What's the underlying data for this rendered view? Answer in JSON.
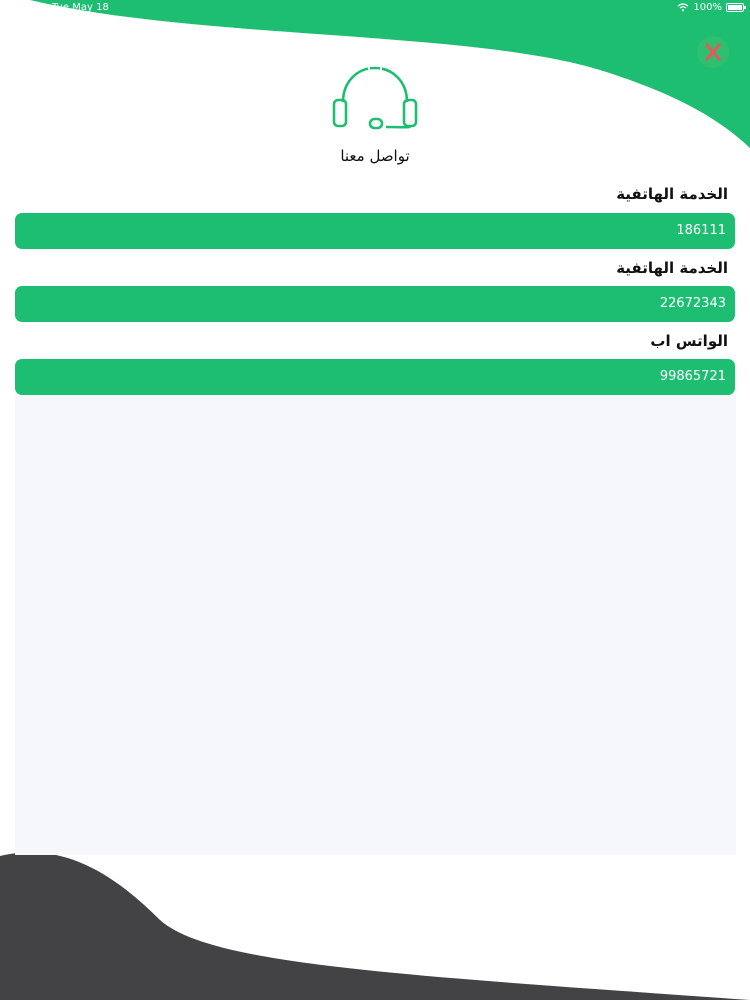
{
  "status_bar": {
    "time": "Tue May 18",
    "battery_percent": "100%"
  },
  "header": {
    "title": "تواصل معنا",
    "icon": "headset-icon",
    "close_icon": "close-icon"
  },
  "contacts": [
    {
      "label": "الخدمة الهاتفية",
      "value": "186111"
    },
    {
      "label": "الخدمة الهاتفية",
      "value": "22672343"
    },
    {
      "label": "الواتس اب",
      "value": "99865721"
    }
  ],
  "colors": {
    "accent": "#1ebe72",
    "dark": "#434346",
    "panel": "#f6f7fb"
  }
}
